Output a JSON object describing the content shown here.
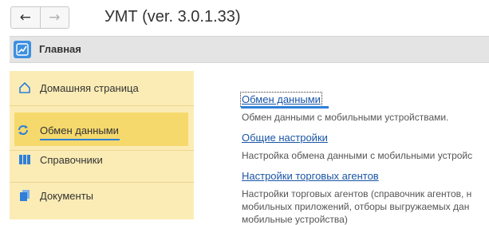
{
  "window": {
    "title": "УМТ (ver. 3.0.1.33)",
    "back_icon": "arrow-left-icon",
    "forward_icon": "arrow-right-icon"
  },
  "section": {
    "title": "Главная",
    "icon": "chart-icon"
  },
  "sidebar": {
    "items": [
      {
        "label": "Домашняя страница",
        "icon": "home-icon"
      },
      {
        "label": "Обмен данными",
        "icon": "sync-icon",
        "active": true
      },
      {
        "label": "Справочники",
        "icon": "catalog-icon"
      },
      {
        "label": "Документы",
        "icon": "documents-icon"
      }
    ]
  },
  "main": {
    "links": [
      {
        "title": "Обмен данными",
        "description": "Обмен данными с мобильными устройствами."
      },
      {
        "title": "Общие настройки",
        "description": "Настройка обмена данными с мобильными устройс"
      },
      {
        "title": "Настройки торговых агентов",
        "description_lines": [
          "Настройки торговых агентов (справочник агентов, н",
          "мобильных приложений, отборы выгружаемых дан",
          "мобильные устройства)"
        ]
      }
    ]
  },
  "colors": {
    "accent": "#2f7fd8",
    "sidebar_bg": "#fbecb5",
    "active_bg": "#f6d96c",
    "link": "#1a55a6"
  }
}
